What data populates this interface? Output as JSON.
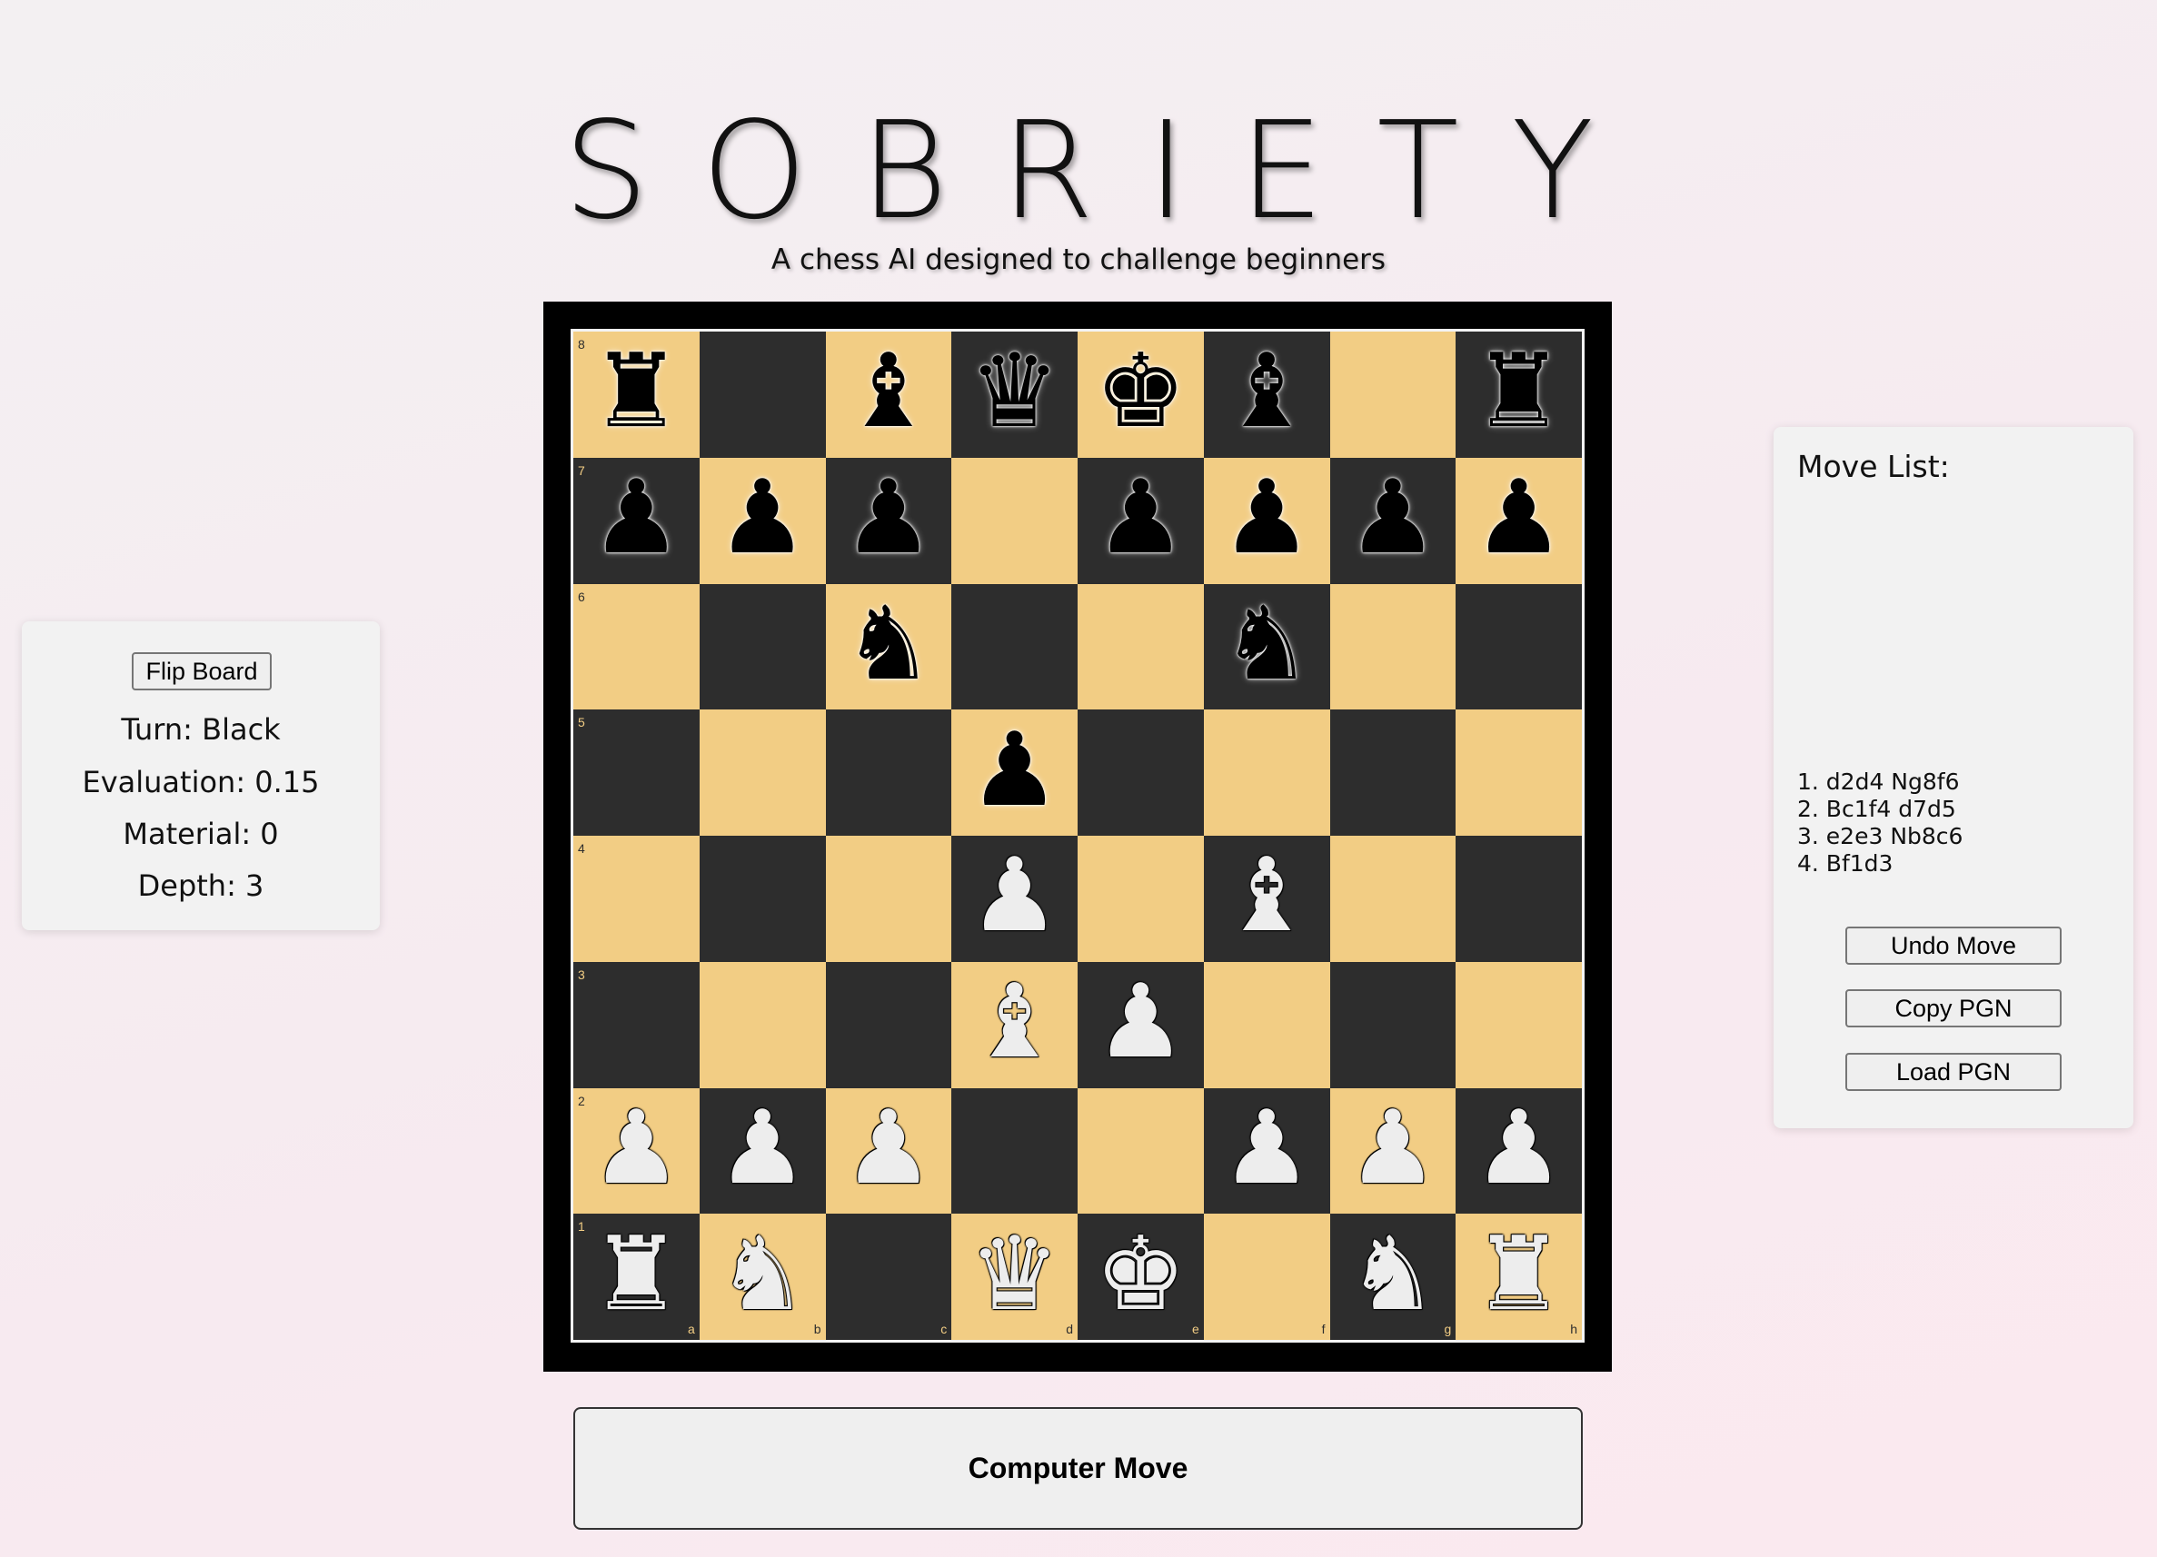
{
  "header": {
    "title": "SOBRIETY",
    "subtitle": "A chess AI designed to challenge beginners"
  },
  "left_panel": {
    "flip_label": "Flip Board",
    "turn": "Turn: Black",
    "evaluation": "Evaluation: 0.15",
    "material": "Material: 0",
    "depth": "Depth: 3"
  },
  "right_panel": {
    "title": "Move List:",
    "moves": [
      "1. d2d4 Ng8f6",
      "2. Bc1f4 d7d5",
      "3. e2e3 Nb8c6",
      "4. Bf1d3"
    ],
    "undo_label": "Undo Move",
    "copy_label": "Copy PGN",
    "load_label": "Load PGN"
  },
  "computer_move_label": "Computer Move",
  "board": {
    "files": [
      "a",
      "b",
      "c",
      "d",
      "e",
      "f",
      "g",
      "h"
    ],
    "ranks": [
      "8",
      "7",
      "6",
      "5",
      "4",
      "3",
      "2",
      "1"
    ],
    "position": [
      [
        "r",
        "",
        "b",
        "q",
        "k",
        "b",
        "",
        "r"
      ],
      [
        "p",
        "p",
        "p",
        "",
        "p",
        "p",
        "p",
        "p"
      ],
      [
        "",
        "",
        "n",
        "",
        "",
        "n",
        "",
        ""
      ],
      [
        "",
        "",
        "",
        "p",
        "",
        "",
        "",
        ""
      ],
      [
        "",
        "",
        "",
        "P",
        "",
        "B",
        "",
        ""
      ],
      [
        "",
        "",
        "",
        "B",
        "P",
        "",
        "",
        ""
      ],
      [
        "P",
        "P",
        "P",
        "",
        "",
        "P",
        "P",
        "P"
      ],
      [
        "R",
        "N",
        "",
        "Q",
        "K",
        "",
        "N",
        "R"
      ]
    ],
    "light_color": "#f2cd84",
    "dark_color": "#2d2d2d"
  }
}
